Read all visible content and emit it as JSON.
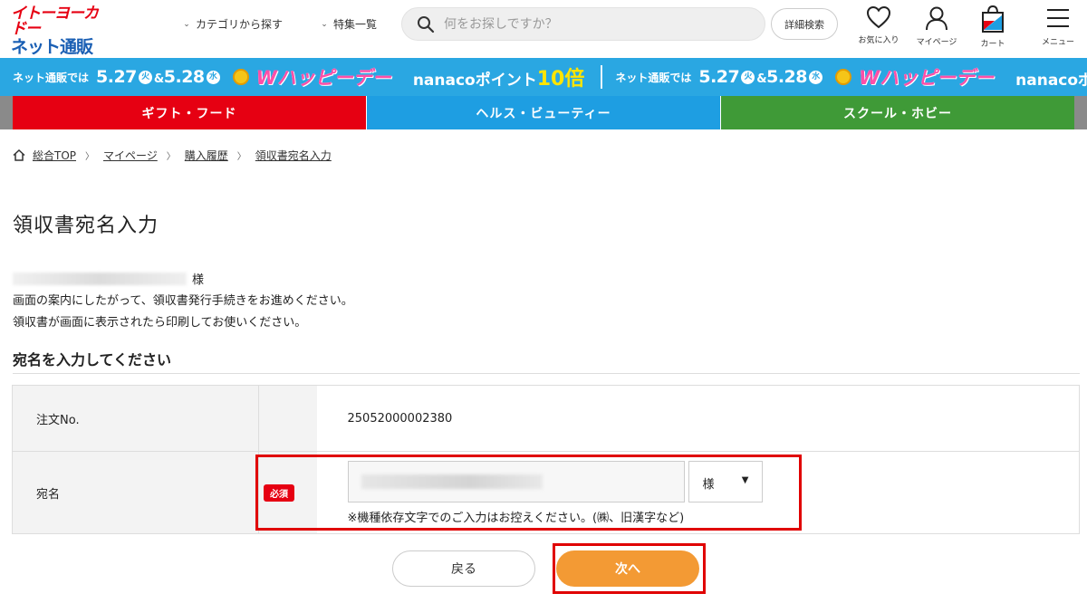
{
  "header": {
    "logo_line1": "イトーヨーカドー",
    "logo_line2": "ネット通販",
    "nav": [
      {
        "label": "カテゴリから探す"
      },
      {
        "label": "特集一覧"
      }
    ],
    "search_placeholder": "何をお探しですか？",
    "advanced_search": "詳細検索",
    "icons": {
      "favorites": "お気に入り",
      "mypage": "マイページ",
      "cart": "カート",
      "menu": "メニュー"
    }
  },
  "banner": {
    "lead": "ネット通販では",
    "date1": "5.27",
    "dow1": "火",
    "amp": "&",
    "date2": "5.28",
    "dow2": "水",
    "happy": "Wハッピーデー",
    "nanaco": "nanacoポイント",
    "times": "10倍"
  },
  "categories": [
    {
      "label": "ギフト・フード",
      "color": "#e60012"
    },
    {
      "label": "ヘルス・ビューティー",
      "color": "#1e9ee2"
    },
    {
      "label": "スクール・ホビー",
      "color": "#3f9a37"
    }
  ],
  "breadcrumb": [
    "総合TOP",
    "マイページ",
    "購入履歴",
    "領収書宛名入力"
  ],
  "page_title": "領収書宛名入力",
  "greeting_suffix": "様",
  "messages": [
    "画面の案内にしたがって、領収書発行手続きをお進めください。",
    "領収書が画面に表示されたら印刷してお使いください。"
  ],
  "section_title": "宛名を入力してください",
  "form": {
    "order_label": "注文No.",
    "order_value": "25052000002380",
    "addressee_label": "宛名",
    "required_badge": "必須",
    "honorific": "様",
    "note": "※機種依存文字でのご入力はお控えください。(㈱、旧漢字など)"
  },
  "buttons": {
    "back": "戻る",
    "next": "次へ"
  },
  "colors": {
    "brand_red": "#e60012",
    "brand_blue": "#1a5fb4",
    "next_button": "#f39a34",
    "highlight": "#e00000"
  }
}
